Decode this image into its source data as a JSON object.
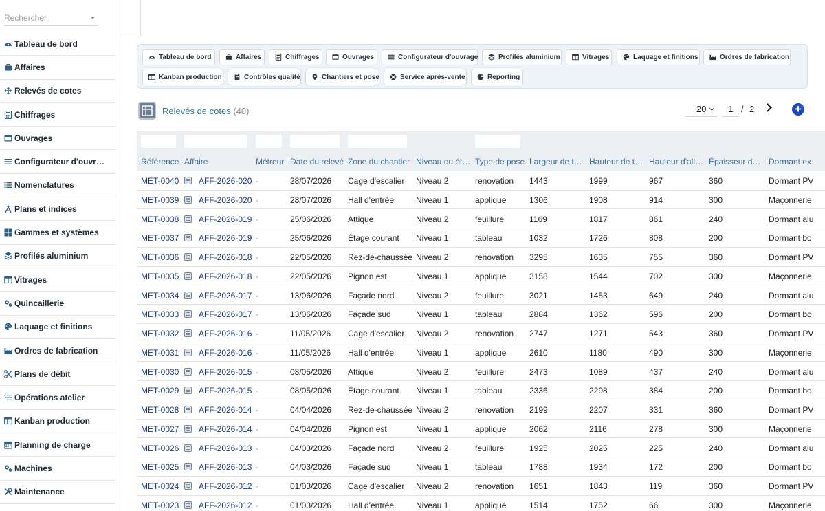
{
  "sidebar": {
    "search_placeholder": "Rechercher",
    "items": [
      {
        "label": "Tableau de bord",
        "icon": "gauge-icon"
      },
      {
        "label": "Affaires",
        "icon": "briefcase-icon"
      },
      {
        "label": "Relevés de cotes",
        "icon": "arrows-icon"
      },
      {
        "label": "Chiffrages",
        "icon": "calculator-icon"
      },
      {
        "label": "Ouvrages",
        "icon": "window-icon"
      },
      {
        "label": "Configurateur d'ouvr…",
        "icon": "sliders-icon"
      },
      {
        "label": "Nomenclatures",
        "icon": "list-icon"
      },
      {
        "label": "Plans et indices",
        "icon": "compass-icon"
      },
      {
        "label": "Gammes et systèmes",
        "icon": "grid-icon"
      },
      {
        "label": "Profilés aluminium",
        "icon": "layers-icon"
      },
      {
        "label": "Vitrages",
        "icon": "pane-icon"
      },
      {
        "label": "Quincaillerie",
        "icon": "gears-icon"
      },
      {
        "label": "Laquage et finitions",
        "icon": "palette-icon"
      },
      {
        "label": "Ordres de fabrication",
        "icon": "factory-icon"
      },
      {
        "label": "Plans de débit",
        "icon": "scissors-icon"
      },
      {
        "label": "Opérations atelier",
        "icon": "tasklist-icon"
      },
      {
        "label": "Kanban production",
        "icon": "kanban-icon"
      },
      {
        "label": "Planning de charge",
        "icon": "calendar-icon"
      },
      {
        "label": "Machines",
        "icon": "cogs-icon"
      },
      {
        "label": "Maintenance",
        "icon": "tools-icon"
      }
    ]
  },
  "shortcuts": [
    {
      "label": "Tableau de bord",
      "icon": "gauge-icon"
    },
    {
      "label": "Affaires",
      "icon": "briefcase-icon"
    },
    {
      "label": "Chiffrages",
      "icon": "calculator-icon"
    },
    {
      "label": "Ouvrages",
      "icon": "window-icon"
    },
    {
      "label": "Configurateur d'ouvrage",
      "icon": "sliders-icon"
    },
    {
      "label": "Profilés aluminium",
      "icon": "layers-icon"
    },
    {
      "label": "Vitrages",
      "icon": "pane-icon"
    },
    {
      "label": "Laquage et finitions",
      "icon": "palette-icon"
    },
    {
      "label": "Ordres de fabrication",
      "icon": "factory-icon"
    },
    {
      "label": "Kanban production",
      "icon": "kanban-icon"
    },
    {
      "label": "Contrôles qualité",
      "icon": "clipboard-icon"
    },
    {
      "label": "Chantiers et pose",
      "icon": "pin-icon"
    },
    {
      "label": "Service après-vente",
      "icon": "support-icon"
    },
    {
      "label": "Reporting",
      "icon": "pie-icon"
    }
  ],
  "list": {
    "title": "Relevés de cotes",
    "count": "(40)",
    "page_size": "20",
    "page": "1",
    "page_sep": "/",
    "page_total": "2"
  },
  "columns": [
    "Référence",
    "Affaire",
    "Métreur",
    "Date du relevé",
    "Zone du chantier",
    "Niveau ou ét…",
    "Type de pose",
    "Largeur de t…",
    "Hauteur de t…",
    "Hauteur d'all…",
    "Épaisseur d…",
    "Dormant ex"
  ],
  "rows": [
    [
      "MET-0040",
      "AFF-2026-020",
      "-",
      "28/07/2026",
      "Cage d'escalier",
      "Niveau 2",
      "renovation",
      "1443",
      "1999",
      "967",
      "360",
      "Dormant PV"
    ],
    [
      "MET-0039",
      "AFF-2026-020",
      "-",
      "28/07/2026",
      "Hall d'entrée",
      "Niveau 1",
      "applique",
      "1306",
      "1908",
      "914",
      "300",
      "Maçonnerie"
    ],
    [
      "MET-0038",
      "AFF-2026-019",
      "-",
      "25/06/2026",
      "Attique",
      "Niveau 2",
      "feuillure",
      "1169",
      "1817",
      "861",
      "240",
      "Dormant alu"
    ],
    [
      "MET-0037",
      "AFF-2026-019",
      "-",
      "25/06/2026",
      "Étage courant",
      "Niveau 1",
      "tableau",
      "1032",
      "1726",
      "808",
      "200",
      "Dormant bo"
    ],
    [
      "MET-0036",
      "AFF-2026-018",
      "-",
      "22/05/2026",
      "Rez-de-chaussée",
      "Niveau 2",
      "renovation",
      "3295",
      "1635",
      "755",
      "360",
      "Dormant PV"
    ],
    [
      "MET-0035",
      "AFF-2026-018",
      "-",
      "22/05/2026",
      "Pignon est",
      "Niveau 1",
      "applique",
      "3158",
      "1544",
      "702",
      "300",
      "Maçonnerie"
    ],
    [
      "MET-0034",
      "AFF-2026-017",
      "-",
      "13/06/2026",
      "Façade nord",
      "Niveau 2",
      "feuillure",
      "3021",
      "1453",
      "649",
      "240",
      "Dormant alu"
    ],
    [
      "MET-0033",
      "AFF-2026-017",
      "-",
      "13/06/2026",
      "Façade sud",
      "Niveau 1",
      "tableau",
      "2884",
      "1362",
      "596",
      "200",
      "Dormant bo"
    ],
    [
      "MET-0032",
      "AFF-2026-016",
      "-",
      "11/05/2026",
      "Cage d'escalier",
      "Niveau 2",
      "renovation",
      "2747",
      "1271",
      "543",
      "360",
      "Dormant PV"
    ],
    [
      "MET-0031",
      "AFF-2026-016",
      "-",
      "11/05/2026",
      "Hall d'entrée",
      "Niveau 1",
      "applique",
      "2610",
      "1180",
      "490",
      "300",
      "Maçonnerie"
    ],
    [
      "MET-0030",
      "AFF-2026-015",
      "-",
      "08/05/2026",
      "Attique",
      "Niveau 2",
      "feuillure",
      "2473",
      "1089",
      "437",
      "240",
      "Dormant alu"
    ],
    [
      "MET-0029",
      "AFF-2026-015",
      "-",
      "08/05/2026",
      "Étage courant",
      "Niveau 1",
      "tableau",
      "2336",
      "2298",
      "384",
      "200",
      "Dormant bo"
    ],
    [
      "MET-0028",
      "AFF-2026-014",
      "-",
      "04/04/2026",
      "Rez-de-chaussée",
      "Niveau 2",
      "renovation",
      "2199",
      "2207",
      "331",
      "360",
      "Dormant PV"
    ],
    [
      "MET-0027",
      "AFF-2026-014",
      "-",
      "04/04/2026",
      "Pignon est",
      "Niveau 1",
      "applique",
      "2062",
      "2116",
      "278",
      "300",
      "Maçonnerie"
    ],
    [
      "MET-0026",
      "AFF-2026-013",
      "-",
      "04/03/2026",
      "Façade nord",
      "Niveau 2",
      "feuillure",
      "1925",
      "2025",
      "225",
      "240",
      "Dormant alu"
    ],
    [
      "MET-0025",
      "AFF-2026-013",
      "-",
      "04/03/2026",
      "Façade sud",
      "Niveau 1",
      "tableau",
      "1788",
      "1934",
      "172",
      "200",
      "Dormant bo"
    ],
    [
      "MET-0024",
      "AFF-2026-012",
      "-",
      "01/03/2026",
      "Cage d'escalier",
      "Niveau 2",
      "renovation",
      "1651",
      "1843",
      "119",
      "360",
      "Dormant PV"
    ],
    [
      "MET-0023",
      "AFF-2026-012",
      "-",
      "01/03/2026",
      "Hall d'entrée",
      "Niveau 1",
      "applique",
      "1514",
      "1752",
      "66",
      "300",
      "Maçonnerie"
    ]
  ],
  "colors": {
    "accent": "#1e4bb8",
    "title": "#2a7b94",
    "header_text": "#3e6fa0",
    "link": "#1e3a7a",
    "panel_bg": "#eef3f8"
  }
}
